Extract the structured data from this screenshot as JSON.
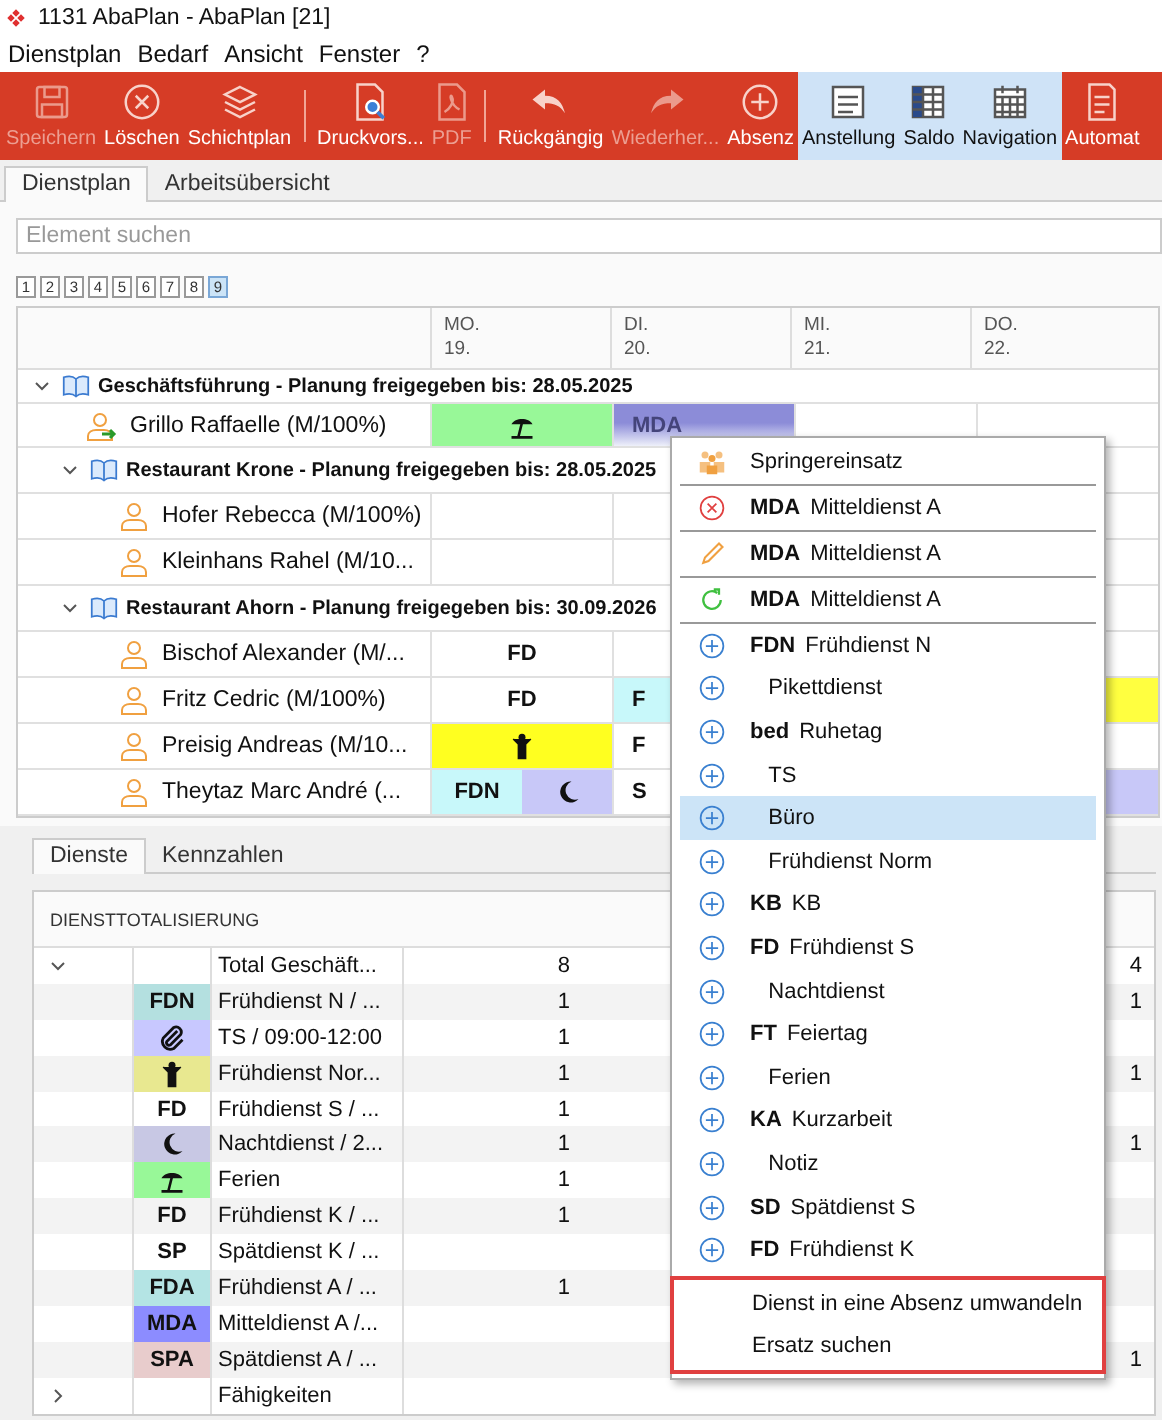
{
  "window": {
    "title": "1131 AbaPlan - AbaPlan [21]"
  },
  "menu_bar": [
    "Dienstplan",
    "Bedarf",
    "Ansicht",
    "Fenster",
    "?"
  ],
  "toolbar": [
    {
      "kind": "save",
      "label": "Speichern",
      "disabled": true,
      "selected": false
    },
    {
      "kind": "delete",
      "label": "Löschen",
      "disabled": false,
      "selected": false
    },
    {
      "kind": "layers",
      "label": "Schichtplan",
      "disabled": false,
      "selected": false
    },
    {
      "kind": "separator"
    },
    {
      "kind": "preview",
      "label": "Druckvors...",
      "disabled": false,
      "selected": false
    },
    {
      "kind": "pdf",
      "label": "PDF",
      "disabled": true,
      "selected": false
    },
    {
      "kind": "separator"
    },
    {
      "kind": "undo",
      "label": "Rückgängig",
      "disabled": false,
      "selected": false
    },
    {
      "kind": "redo",
      "label": "Wiederher...",
      "disabled": true,
      "selected": false
    },
    {
      "kind": "add",
      "label": "Absenz",
      "disabled": false,
      "selected": false
    },
    {
      "kind": "list",
      "label": "Anstellung",
      "disabled": false,
      "selected": true
    },
    {
      "kind": "grid",
      "label": "Saldo",
      "disabled": false,
      "selected": true
    },
    {
      "kind": "calendar",
      "label": "Navigation",
      "disabled": false,
      "selected": true
    },
    {
      "kind": "document",
      "label": "Automat",
      "disabled": false,
      "selected": false
    }
  ],
  "tabs": [
    {
      "label": "Dienstplan",
      "selected": true
    },
    {
      "label": "Arbeitsübersicht",
      "selected": false
    }
  ],
  "search": {
    "placeholder": "Element suchen"
  },
  "levels": [
    {
      "label": "1",
      "selected": false
    },
    {
      "label": "2",
      "selected": false
    },
    {
      "label": "3",
      "selected": false
    },
    {
      "label": "4",
      "selected": false
    },
    {
      "label": "5",
      "selected": false
    },
    {
      "label": "6",
      "selected": false
    },
    {
      "label": "7",
      "selected": false
    },
    {
      "label": "8",
      "selected": false
    },
    {
      "label": "9",
      "selected": true
    }
  ],
  "plan": {
    "columns": [
      {
        "day": "MO.",
        "date": "19."
      },
      {
        "day": "DI.",
        "date": "20."
      },
      {
        "day": "MI.",
        "date": "21."
      },
      {
        "day": "DO.",
        "date": "22."
      }
    ],
    "rows": [
      {
        "kind": "group",
        "label": "Geschäftsführung - Planung freigegeben bis: 28.05.2025",
        "expanded": true,
        "children": [
          {
            "kind": "relocated",
            "name": "Grillo Raffaelle (M/100%)",
            "cells": [
              {
                "parts": [
                  {
                    "kind": "umbrella",
                    "color": "#98f898",
                    "selected": false
                  }
                ]
              },
              {
                "parts": [
                  {
                    "kind": "text",
                    "text": "MDA",
                    "color": "#8c8cd8",
                    "selected": true
                  }
                ]
              },
              {},
              {}
            ]
          },
          {
            "kind": "group",
            "label": "Restaurant Krone - Planung freigegeben bis: 28.05.2025",
            "expanded": true,
            "children": [
              {
                "kind": "person",
                "name": "Hofer Rebecca (M/100%)",
                "cells": [
                  {},
                  {},
                  {},
                  {}
                ]
              },
              {
                "kind": "person",
                "name": "Kleinhans Rahel (M/10...",
                "cells": [
                  {},
                  {},
                  {},
                  {}
                ]
              }
            ]
          },
          {
            "kind": "group",
            "label": "Restaurant Ahorn - Planung freigegeben bis: 30.09.2026",
            "expanded": true,
            "children": [
              {
                "kind": "person",
                "name": "Bischof Alexander (M/...",
                "cells": [
                  {
                    "parts": [
                      {
                        "kind": "text",
                        "text": "FD",
                        "selected": false
                      }
                    ]
                  },
                  {},
                  {},
                  {}
                ]
              },
              {
                "kind": "person",
                "name": "Fritz Cedric (M/100%)",
                "cells": [
                  {
                    "parts": [
                      {
                        "kind": "text",
                        "text": "FD",
                        "selected": false
                      }
                    ]
                  },
                  {
                    "parts": [
                      {
                        "kind": "text",
                        "text": "F",
                        "color": "#c8f8fa",
                        "selected": false
                      }
                    ]
                  },
                  {},
                  {
                    "parts": [
                      {
                        "kind": "fill",
                        "color": "#ffff40",
                        "selected": false
                      }
                    ]
                  }
                ]
              },
              {
                "kind": "person",
                "name": "Preisig Andreas (M/10...",
                "cells": [
                  {
                    "parts": [
                      {
                        "kind": "figure",
                        "color": "#ffff20",
                        "selected": false
                      }
                    ]
                  },
                  {
                    "parts": [
                      {
                        "kind": "text",
                        "text": "F",
                        "selected": false
                      }
                    ]
                  },
                  {},
                  {}
                ]
              },
              {
                "kind": "person",
                "name": "Theytaz Marc André (...",
                "cells": [
                  {
                    "parts": [
                      {
                        "kind": "text",
                        "text": "FDN",
                        "color": "#c8f8fa",
                        "selected": false
                      },
                      {
                        "kind": "moon",
                        "color": "#c8c8f8",
                        "selected": false
                      }
                    ]
                  },
                  {
                    "parts": [
                      {
                        "kind": "text",
                        "text": "S",
                        "selected": false
                      }
                    ]
                  },
                  {},
                  {
                    "parts": [
                      {
                        "kind": "fill",
                        "color": "#c8c8f8",
                        "selected": false
                      }
                    ]
                  }
                ]
              }
            ]
          }
        ]
      }
    ]
  },
  "totals": {
    "tabs": [
      {
        "label": "Dienste",
        "selected": true
      },
      {
        "label": "Kennzahlen",
        "selected": false
      }
    ],
    "title": "DIENSTTOTALISIERUNG",
    "rows": [
      {
        "name": "Total Geschäft...",
        "expanded": true,
        "column_4": "8",
        "column_7": "4",
        "children": [
          {
            "code": {
              "kind": "text",
              "text": "FDN",
              "color": "#b4e0e0"
            },
            "name": "Frühdienst N / ...",
            "column_4": "1",
            "column_7": "1"
          },
          {
            "code": {
              "kind": "clip",
              "color": "#c8c8ff"
            },
            "name": "TS / 09:00-12:00",
            "column_4": "1"
          },
          {
            "code": {
              "kind": "figure",
              "color": "#e8e890"
            },
            "name": "Frühdienst Nor...",
            "column_4": "1",
            "column_7": "1"
          },
          {
            "code": {
              "kind": "text",
              "text": "FD"
            },
            "name": "Frühdienst S / ...",
            "column_4": "1"
          },
          {
            "code": {
              "kind": "moon",
              "color": "#c8c8e4"
            },
            "name": "Nachtdienst / 2...",
            "column_4": "1",
            "column_7": "1"
          },
          {
            "code": {
              "kind": "umbrella",
              "color": "#98f898"
            },
            "name": "Ferien",
            "column_4": "1"
          },
          {
            "code": {
              "kind": "text",
              "text": "FD"
            },
            "name": "Frühdienst K / ...",
            "column_4": "1"
          },
          {
            "code": {
              "kind": "text",
              "text": "SP"
            },
            "name": "Spätdienst K / ..."
          },
          {
            "code": {
              "kind": "text",
              "text": "FDA",
              "color": "#b4e4e4"
            },
            "name": "Frühdienst A / ...",
            "column_4": "1"
          },
          {
            "code": {
              "kind": "text",
              "text": "MDA",
              "color": "#8c8cff"
            },
            "name": "Mitteldienst A /..."
          },
          {
            "code": {
              "kind": "text",
              "text": "SPA",
              "color": "#e8cccc"
            },
            "name": "Spätdienst A / ...",
            "column_7": "1"
          }
        ]
      },
      {
        "name": "Fähigkeiten",
        "expanded": false
      }
    ]
  },
  "context_menu": {
    "items": [
      {
        "kind": "springer",
        "label": "Springereinsatz",
        "selected": false,
        "framed": false
      },
      {
        "kind": "delete",
        "code": "MDA",
        "label": "Mitteldienst A",
        "selected": false,
        "framed": false
      },
      {
        "kind": "edit",
        "code": "MDA",
        "label": "Mitteldienst A",
        "selected": false,
        "framed": false
      },
      {
        "kind": "reload",
        "code": "MDA",
        "label": "Mitteldienst A",
        "selected": false,
        "framed": false
      },
      {
        "kind": "add",
        "code": "FDN",
        "label": "Frühdienst N",
        "selected": false,
        "framed": false
      },
      {
        "kind": "add",
        "label": "Pikettdienst",
        "selected": false,
        "framed": false
      },
      {
        "kind": "add",
        "code": "bed",
        "label": "Ruhetag",
        "selected": false,
        "framed": false
      },
      {
        "kind": "add",
        "label": "TS",
        "selected": false,
        "framed": false
      },
      {
        "kind": "add",
        "label": "Büro",
        "selected": true,
        "framed": false
      },
      {
        "kind": "add",
        "label": "Frühdienst Norm",
        "selected": false,
        "framed": false
      },
      {
        "kind": "add",
        "code": "KB",
        "label": "KB",
        "selected": false,
        "framed": false
      },
      {
        "kind": "add",
        "code": "FD",
        "label": "Frühdienst S",
        "selected": false,
        "framed": false
      },
      {
        "kind": "add",
        "label": "Nachtdienst",
        "selected": false,
        "framed": false
      },
      {
        "kind": "add",
        "code": "FT",
        "label": "Feiertag",
        "selected": false,
        "framed": false
      },
      {
        "kind": "add",
        "label": "Ferien",
        "selected": false,
        "framed": false
      },
      {
        "kind": "add",
        "code": "KA",
        "label": "Kurzarbeit",
        "selected": false,
        "framed": false
      },
      {
        "kind": "add",
        "label": "Notiz",
        "selected": false,
        "framed": false
      },
      {
        "kind": "add",
        "code": "SD",
        "label": "Spätdienst S",
        "selected": false,
        "framed": false
      },
      {
        "kind": "add",
        "code": "FD",
        "label": "Frühdienst K",
        "selected": false,
        "framed": false
      },
      {
        "kind": "action",
        "label": "Dienst in eine Absenz umwandeln",
        "selected": false,
        "framed": true
      },
      {
        "kind": "action",
        "label": "Ersatz suchen",
        "selected": false,
        "framed": true
      }
    ]
  }
}
